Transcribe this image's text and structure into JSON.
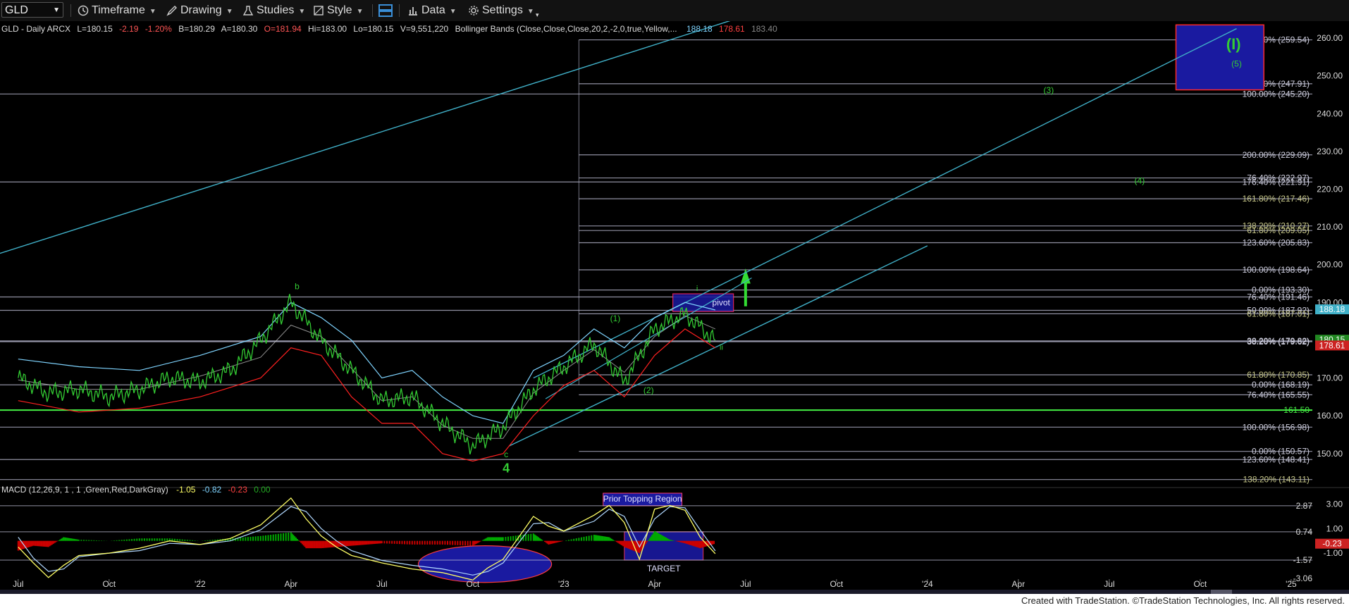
{
  "toolbar": {
    "symbol": "GLD",
    "timeframe": "Timeframe",
    "drawing": "Drawing",
    "studies": "Studies",
    "style": "Style",
    "data": "Data",
    "settings": "Settings"
  },
  "header": {
    "title": "GLD - Daily  ARCX",
    "last": "L=180.15",
    "change": "-2.19",
    "pct": "-1.20%",
    "bid": "B=180.29",
    "ask": "A=180.30",
    "open": "O=181.94",
    "high": "Hi=183.00",
    "low": "Lo=180.15",
    "volume": "V=9,551,220",
    "study": "Bollinger Bands (Close,Close,Close,20,2,-2,0,true,Yellow,...",
    "bb_upper": "188.18",
    "bb_lower": "178.61",
    "bb_mid": "183.40"
  },
  "macd_header": {
    "title": "MACD (12,26,9, 1 , 1 ,Green,Red,DarkGray)",
    "macd": "-1.05",
    "signal": "-0.82",
    "hist": "-0.23",
    "zero": "0.00"
  },
  "colors": {
    "background": "#000000",
    "price": "#33cc33",
    "bb_upper": "#7fd4ff",
    "bb_lower": "#ff2020",
    "bb_mid": "#c8c8c8",
    "macd": "#ffff66",
    "signal": "#b0d8ff",
    "hist_up": "#00aa00",
    "hist_down": "#cc0000",
    "fib_line": "#c0c0d8",
    "channel": "#40b0c8",
    "wave_label": "#33cc33",
    "region_fill": "#1a1aa0"
  },
  "chart_data": {
    "type": "line",
    "symbol": "GLD",
    "timeframe": "Daily",
    "ylim": [
      141,
      263
    ],
    "price_axis_ticks": [
      "260.00",
      "250.00",
      "240.00",
      "230.00",
      "220.00",
      "210.00",
      "200.00",
      "190.00",
      "170.00",
      "160.00",
      "150.00"
    ],
    "x_tick_labels": [
      "Jul",
      "Oct",
      "'22",
      "Apr",
      "Jul",
      "Oct",
      "'23",
      "Apr",
      "Jul",
      "Oct",
      "'24",
      "Apr",
      "Jul",
      "Oct",
      "'25"
    ],
    "x_ticks_month_index": [
      0,
      3,
      6,
      9,
      12,
      15,
      18,
      21,
      24,
      27,
      30,
      33,
      36,
      39,
      42
    ],
    "x_range_months": [
      -0.6,
      42.7
    ],
    "price_series": {
      "name": "GLD",
      "points": [
        [
          0,
          170
        ],
        [
          1,
          166
        ],
        [
          2,
          167
        ],
        [
          3,
          165
        ],
        [
          4,
          167
        ],
        [
          5,
          170
        ],
        [
          6,
          169
        ],
        [
          7,
          172
        ],
        [
          8,
          180
        ],
        [
          9,
          190
        ],
        [
          10,
          180
        ],
        [
          11,
          172
        ],
        [
          12,
          164
        ],
        [
          13,
          165
        ],
        [
          14,
          158
        ],
        [
          15,
          152
        ],
        [
          16,
          157
        ],
        [
          17,
          167
        ],
        [
          18,
          173
        ],
        [
          19,
          179
        ],
        [
          20,
          169
        ],
        [
          21,
          183
        ],
        [
          22,
          187
        ],
        [
          23,
          180
        ]
      ]
    },
    "bb_upper_series": [
      [
        0,
        175
      ],
      [
        2,
        173
      ],
      [
        4,
        172
      ],
      [
        6,
        176
      ],
      [
        8,
        181
      ],
      [
        9,
        190
      ],
      [
        10,
        186
      ],
      [
        11,
        180
      ],
      [
        12,
        170
      ],
      [
        13,
        172
      ],
      [
        14,
        165
      ],
      [
        15,
        160
      ],
      [
        16,
        158
      ],
      [
        17,
        172
      ],
      [
        18,
        176
      ],
      [
        19,
        183
      ],
      [
        20,
        178
      ],
      [
        21,
        186
      ],
      [
        22,
        190
      ],
      [
        23,
        188
      ]
    ],
    "bb_lower_series": [
      [
        0,
        164
      ],
      [
        2,
        161
      ],
      [
        4,
        162
      ],
      [
        6,
        165
      ],
      [
        8,
        170
      ],
      [
        9,
        178
      ],
      [
        10,
        176
      ],
      [
        11,
        165
      ],
      [
        12,
        158
      ],
      [
        13,
        158
      ],
      [
        14,
        150
      ],
      [
        15,
        148
      ],
      [
        16,
        150
      ],
      [
        17,
        160
      ],
      [
        18,
        168
      ],
      [
        19,
        172
      ],
      [
        20,
        165
      ],
      [
        21,
        176
      ],
      [
        22,
        183
      ],
      [
        23,
        178
      ]
    ],
    "fib_levels": [
      {
        "label": "300.00% (259.54)",
        "value": 259.54
      },
      {
        "label": "261.80% (247.91)",
        "value": 247.91
      },
      {
        "label": "100.00% (245.20)",
        "value": 245.2
      },
      {
        "label": "200.00% (229.09)",
        "value": 229.09
      },
      {
        "label": "76.40% (222.97)",
        "value": 222.97
      },
      {
        "label": "176.40% (221.91)",
        "value": 221.91
      },
      {
        "label": "161.80% (217.46)",
        "value": 217.46
      },
      {
        "label": "138.20% (210.27)",
        "value": 210.27
      },
      {
        "label": "61.80% (209.05)",
        "value": 209.05
      },
      {
        "label": "123.60% (205.83)",
        "value": 205.83
      },
      {
        "label": "100.00% (198.64)",
        "value": 198.64
      },
      {
        "label": "0.00% (193.30)",
        "value": 193.3
      },
      {
        "label": "76.40% (191.46)",
        "value": 191.46
      },
      {
        "label": "50.00% (187.92)",
        "value": 187.92
      },
      {
        "label": "61.80% (187.01)",
        "value": 187.01
      },
      {
        "label": "38.20% (179.82)",
        "value": 179.82
      },
      {
        "label": "38.20% (179.62)",
        "value": 179.62
      },
      {
        "label": "61.80% (170.85)",
        "value": 170.85
      },
      {
        "label": "0.00% (168.19)",
        "value": 168.19
      },
      {
        "label": "76.40% (165.55)",
        "value": 165.55
      },
      {
        "label": "100.00% (156.98)",
        "value": 156.98
      },
      {
        "label": "0.00% (150.57)",
        "value": 150.57
      },
      {
        "label": "123.60% (148.41)",
        "value": 148.41
      },
      {
        "label": "138.20% (143.11)",
        "value": 143.11
      }
    ],
    "support_line": {
      "label": "161.50",
      "value": 161.5
    },
    "price_tags": [
      {
        "label": "188.18",
        "value": 188.18,
        "color": "#40b0c8"
      },
      {
        "label": "180.15",
        "value": 180.15,
        "color": "#228822"
      },
      {
        "label": "178.61",
        "value": 178.61,
        "color": "#cc2222"
      }
    ],
    "wave_labels": [
      {
        "text": "b",
        "month": 9.2,
        "price": 193.5,
        "size": 12
      },
      {
        "text": "c",
        "month": 16.1,
        "price": 149,
        "size": 12
      },
      {
        "text": "4",
        "month": 16.1,
        "price": 145,
        "size": 18
      },
      {
        "text": "(1)",
        "month": 19.7,
        "price": 185,
        "size": 12
      },
      {
        "text": "(2)",
        "month": 20.8,
        "price": 166,
        "size": 12
      },
      {
        "text": "i",
        "month": 22.4,
        "price": 193,
        "size": 11
      },
      {
        "text": "ii",
        "month": 23.2,
        "price": 177.5,
        "size": 11
      },
      {
        "text": "(3)",
        "month": 34.0,
        "price": 245.5,
        "size": 12
      },
      {
        "text": "(4)",
        "month": 37.0,
        "price": 221.5,
        "size": 12
      },
      {
        "text": "(5)",
        "month": 40.2,
        "price": 252.5,
        "size": 12
      },
      {
        "text": "(I)",
        "month": 40.1,
        "price": 257,
        "size": 22
      }
    ],
    "pivot_label": "pivot",
    "macd": {
      "ylim": [
        -3.3,
        3.9
      ],
      "axis_labels": [
        {
          "label": "2.87",
          "value": 2.87
        },
        {
          "label": "3.00",
          "value": 3.0
        },
        {
          "label": "0.74",
          "value": 0.74
        },
        {
          "label": "1.00",
          "value": 1.0
        },
        {
          "label": "-0.23",
          "value": -0.23
        },
        {
          "label": "-1.00",
          "value": -1.0
        },
        {
          "label": "-1.57",
          "value": -1.57
        },
        {
          "label": "-3.06",
          "value": -3.06
        }
      ],
      "macd_series": [
        [
          0,
          -0.5
        ],
        [
          0.5,
          -1.8
        ],
        [
          1,
          -3
        ],
        [
          1.5,
          -2.0
        ],
        [
          2,
          -1.2
        ],
        [
          3,
          -1.0
        ],
        [
          4,
          -0.6
        ],
        [
          5,
          0
        ],
        [
          6,
          -0.3
        ],
        [
          7,
          0.2
        ],
        [
          8,
          1.3
        ],
        [
          9,
          3.5
        ],
        [
          9.5,
          1.8
        ],
        [
          10,
          0.4
        ],
        [
          10.5,
          -0.5
        ],
        [
          11,
          -1.2
        ],
        [
          11.5,
          -1.5
        ],
        [
          12,
          -1.8
        ],
        [
          13,
          -2.3
        ],
        [
          14,
          -2.6
        ],
        [
          15,
          -3.2
        ],
        [
          15.5,
          -2.2
        ],
        [
          16,
          -1.5
        ],
        [
          17,
          2.0
        ],
        [
          17.5,
          1.2
        ],
        [
          18,
          0.8
        ],
        [
          19,
          2.1
        ],
        [
          19.5,
          2.9
        ],
        [
          20,
          1.5
        ],
        [
          20.5,
          -1.5
        ],
        [
          21,
          2.6
        ],
        [
          21.5,
          2.9
        ],
        [
          22,
          2.5
        ],
        [
          22.5,
          0.3
        ],
        [
          23,
          -1.05
        ]
      ],
      "signal_series": [
        [
          0,
          0.3
        ],
        [
          0.5,
          -1.4
        ],
        [
          1,
          -2.5
        ],
        [
          1.5,
          -2.3
        ],
        [
          2,
          -1.3
        ],
        [
          3,
          -1.0
        ],
        [
          4,
          -0.8
        ],
        [
          5,
          -0.2
        ],
        [
          6,
          -0.3
        ],
        [
          7,
          0
        ],
        [
          8,
          0.9
        ],
        [
          9,
          2.8
        ],
        [
          9.5,
          2.4
        ],
        [
          10,
          1.0
        ],
        [
          10.5,
          0
        ],
        [
          11,
          -0.8
        ],
        [
          11.5,
          -1.2
        ],
        [
          12,
          -1.6
        ],
        [
          13,
          -2.0
        ],
        [
          14,
          -2.3
        ],
        [
          15,
          -2.8
        ],
        [
          15.5,
          -2.5
        ],
        [
          16,
          -1.8
        ],
        [
          17,
          1.4
        ],
        [
          17.5,
          1.5
        ],
        [
          18,
          0.8
        ],
        [
          19,
          1.6
        ],
        [
          19.5,
          2.6
        ],
        [
          20,
          2.0
        ],
        [
          20.5,
          -0.5
        ],
        [
          21,
          1.8
        ],
        [
          21.5,
          2.8
        ],
        [
          22,
          2.7
        ],
        [
          22.5,
          0.9
        ],
        [
          23,
          -0.82
        ]
      ]
    },
    "annotations": {
      "prior_topping_region": "Prior Topping Region",
      "target": "TARGET"
    }
  },
  "footer": {
    "credit": "Created with TradeStation. ©TradeStation Technologies, Inc. All rights reserved."
  }
}
